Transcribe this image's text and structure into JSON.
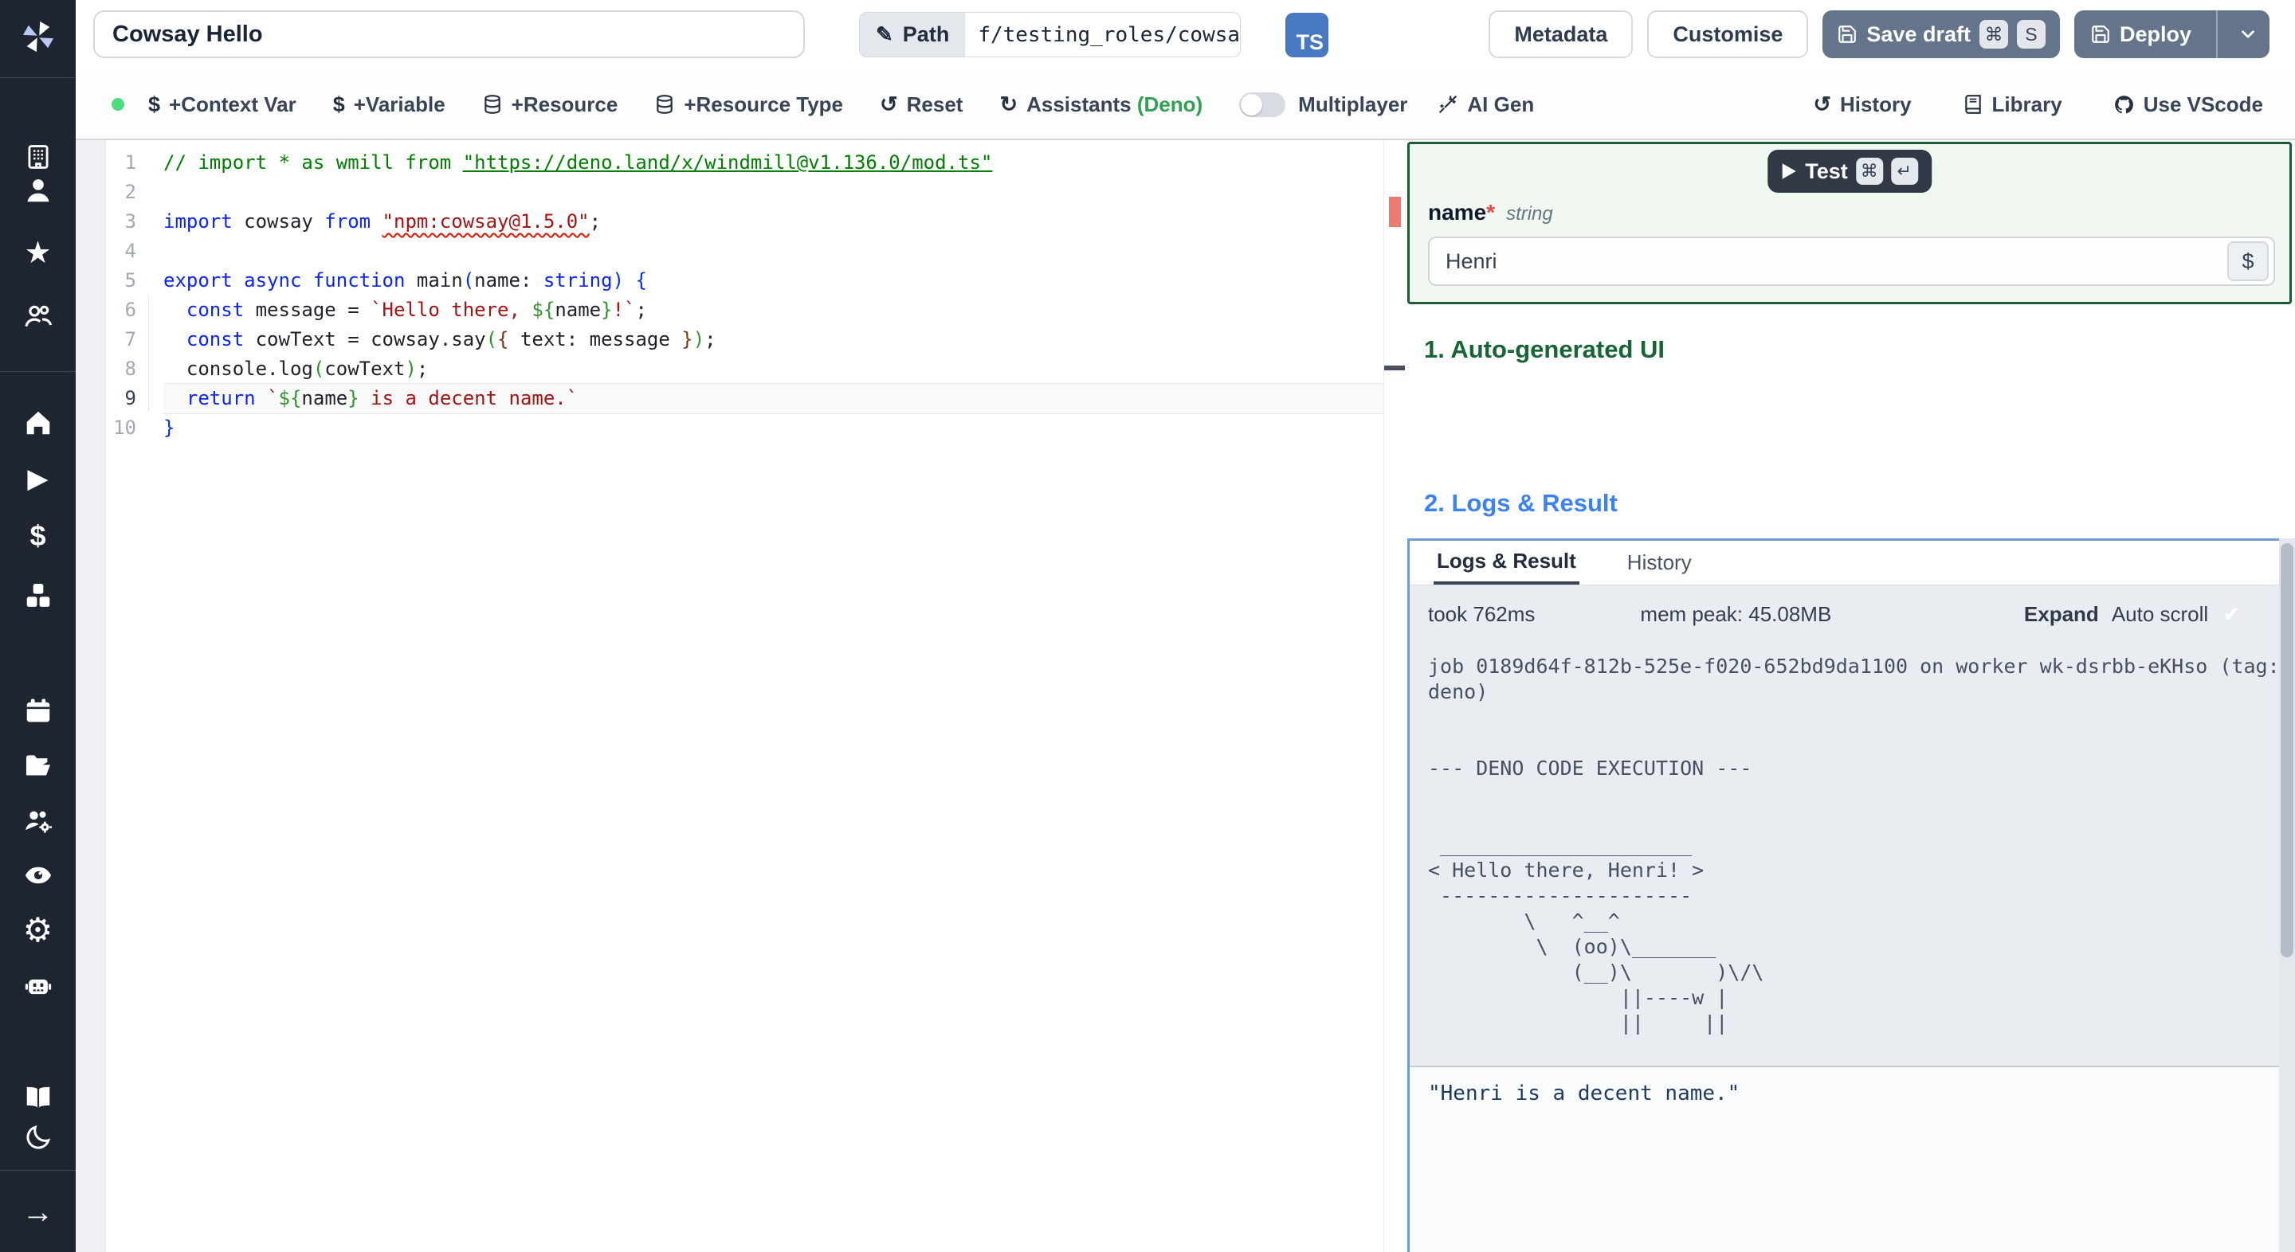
{
  "topbar": {
    "title_value": "Cowsay Hello",
    "path_label": "Path",
    "path_value": "f/testing_roles/cowsa",
    "lang_badge": "TS",
    "metadata_label": "Metadata",
    "customise_label": "Customise",
    "save_draft_label": "Save draft",
    "save_key_cmd": "⌘",
    "save_key_s": "S",
    "deploy_label": "Deploy"
  },
  "toolbar": {
    "context_var": "+Context Var",
    "variable": "+Variable",
    "resource": "+Resource",
    "resource_type": "+Resource Type",
    "reset": "Reset",
    "assistants": "Assistants ",
    "assistants_lang": "(Deno)",
    "multiplayer": "Multiplayer",
    "ai_gen": "AI Gen",
    "history": "History",
    "library": "Library",
    "use_vscode": "Use VScode"
  },
  "icons": {
    "dollar": "$",
    "pencil": "✎",
    "reset": "↺",
    "refresh": "↻",
    "history": "↺",
    "check": "✔",
    "play": "▶",
    "cmd": "⌘",
    "enter": "↵",
    "star": "★",
    "gear": "⚙",
    "arrow_right": "→"
  },
  "editor": {
    "current_line": 9,
    "lines": [
      [
        [
          "// import * as wmill from ",
          "c"
        ],
        [
          "\"https://deno.land/x/windmill@v1.136.0/mod.ts\"",
          "cl"
        ]
      ],
      [],
      [
        [
          "import",
          "k"
        ],
        [
          " cowsay ",
          "p"
        ],
        [
          "from",
          "k"
        ],
        [
          " ",
          "p"
        ],
        [
          "\"npm:cowsay@1.5.0\"",
          "se"
        ],
        [
          ";",
          "p"
        ]
      ],
      [],
      [
        [
          "export",
          "k"
        ],
        [
          " ",
          "p"
        ],
        [
          "async",
          "k"
        ],
        [
          " ",
          "p"
        ],
        [
          "function",
          "k"
        ],
        [
          " ",
          "p"
        ],
        [
          "main",
          "p"
        ],
        [
          "(",
          "b1"
        ],
        [
          "name",
          "p"
        ],
        [
          ": ",
          "p"
        ],
        [
          "string",
          "k"
        ],
        [
          ")",
          "b1"
        ],
        [
          " ",
          "p"
        ],
        [
          "{",
          "b1"
        ]
      ],
      [
        [
          "  ",
          "p"
        ],
        [
          "const",
          "k"
        ],
        [
          " message = ",
          "p"
        ],
        [
          "`Hello there, ",
          "s"
        ],
        [
          "${",
          "b2"
        ],
        [
          "name",
          "p"
        ],
        [
          "}",
          "b2"
        ],
        [
          "!`",
          "s"
        ],
        [
          ";",
          "p"
        ]
      ],
      [
        [
          "  ",
          "p"
        ],
        [
          "const",
          "k"
        ],
        [
          " cowText = cowsay.say",
          "p"
        ],
        [
          "(",
          "b2"
        ],
        [
          "{",
          "b3"
        ],
        [
          " text: message ",
          "p"
        ],
        [
          "}",
          "b3"
        ],
        [
          ")",
          "b2"
        ],
        [
          ";",
          "p"
        ]
      ],
      [
        [
          "  console.log",
          "p"
        ],
        [
          "(",
          "b2"
        ],
        [
          "cowText",
          "p"
        ],
        [
          ")",
          "b2"
        ],
        [
          ";",
          "p"
        ]
      ],
      [
        [
          "  ",
          "p"
        ],
        [
          "return",
          "k"
        ],
        [
          " ",
          "p"
        ],
        [
          "`",
          "s"
        ],
        [
          "${",
          "b2"
        ],
        [
          "name",
          "p"
        ],
        [
          "}",
          "b2"
        ],
        [
          " is a decent name.`",
          "s"
        ]
      ],
      [
        [
          "}",
          "b1"
        ]
      ]
    ]
  },
  "preview": {
    "test_label": "Test",
    "test_key_cmd": "⌘",
    "test_key_enter": "↵",
    "field_name": "name",
    "field_required": "*",
    "field_type": "string",
    "field_value": "Henri",
    "dollar_button": "$",
    "section1": "1. Auto-generated UI",
    "section2": "2. Logs & Result",
    "tab_logs": "Logs & Result",
    "tab_history": "History",
    "took": "took 762ms",
    "mem": "mem peak: 45.08MB",
    "expand": "Expand",
    "autoscroll": "Auto scroll",
    "log_text": "job 0189d64f-812b-525e-f020-652bd9da1100 on worker wk-dsrbb-eKHso (tag:\ndeno)\n\n\n--- DENO CODE EXECUTION ---\n\n\n _____________________\n< Hello there, Henri! >\n ---------------------\n        \\   ^__^\n         \\  (oo)\\_______\n            (__)\\       )\\/\\\n                ||----w |\n                ||     ||",
    "result_text": "\"Henri is a decent name.\""
  },
  "colors": {
    "sidebar_bg": "#1e2530",
    "live_dot_green": "#4ade80",
    "deno_green": "#2fa152",
    "test_panel_green": "#1c5c34",
    "heading_green": "#166534",
    "heading_blue": "#3b82f6",
    "logs_border_blue": "#6d9cd5",
    "error_marker_red": "#ee7b72",
    "action_button_slate": "#64748b",
    "ts_badge_blue": "#4878c0"
  }
}
